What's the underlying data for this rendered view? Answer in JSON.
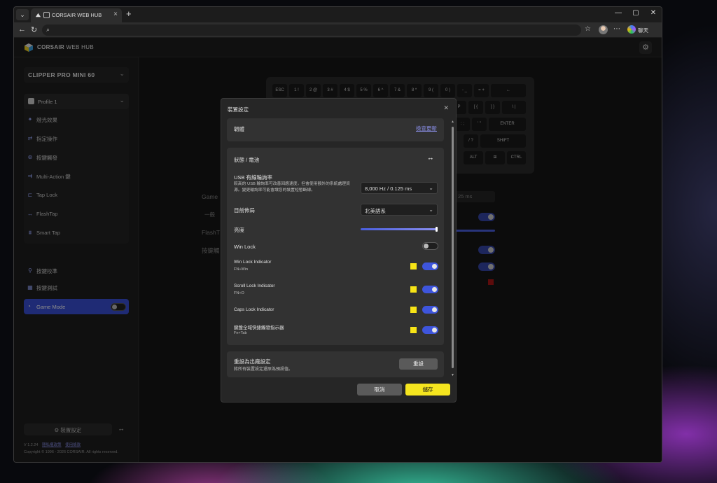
{
  "browser": {
    "tab_title": "CORSAIR WEB HUB",
    "chat_label": "聊天"
  },
  "app": {
    "brand_bold": "CORSAIR",
    "brand_rest": "WEB HUB"
  },
  "sidebar": {
    "device": "CLIPPER PRO MINI 60",
    "profile": "Profile 1",
    "items": [
      {
        "label": "燈光效果",
        "icon": "sparkle-icon"
      },
      {
        "label": "指定操作",
        "icon": "assign-icon"
      },
      {
        "label": "按鍵觸發",
        "icon": "key-trigger-icon"
      },
      {
        "label": "Multi-Action 鍵",
        "icon": "multi-action-icon"
      },
      {
        "label": "Tap Lock",
        "icon": "tap-lock-icon"
      },
      {
        "label": "FlashTap",
        "icon": "flashtap-icon"
      },
      {
        "label": "Smart Tap",
        "icon": "smart-tap-icon"
      }
    ],
    "tools": [
      {
        "label": "按鍵校準",
        "icon": "calibrate-icon"
      },
      {
        "label": "按鍵測試",
        "icon": "key-test-icon"
      }
    ],
    "game_mode": "Game Mode",
    "device_settings": "裝置設定",
    "version": "V 1.2.24",
    "version_links": [
      "隱私權政策",
      "使用條款"
    ],
    "copyright": "Copyright © 1996 - 2026 CORSAIR. All rights reserved."
  },
  "keyboard": {
    "row1": [
      "ESC",
      "1 !",
      "2 @",
      "3 #",
      "4 $",
      "5 %",
      "6 ^",
      "7 &",
      "8 *",
      "9 (",
      "0 )",
      "- _",
      "= +",
      "←"
    ],
    "row2": [
      "P",
      "[ {",
      "] }",
      "\\ |"
    ],
    "row3": [
      ": ;",
      "' \"",
      "ENTER"
    ],
    "row4": [
      "/ ?",
      "SHIFT"
    ],
    "row5": [
      "ALT",
      "⊞",
      "CTRL"
    ]
  },
  "background": {
    "label_game": "Game",
    "label_general": "一般",
    "label_flashtap": "FlashT",
    "label_key_trigger": "按鍵觸",
    "select_value": "25 ms"
  },
  "modal": {
    "title": "裝置設定",
    "firmware": {
      "label": "韌體",
      "check_update": "檢查更新"
    },
    "status": {
      "title": "狀態 / 電池",
      "usb_rate_label": "USB 有線輪詢率",
      "usb_rate_desc": "較高的 USB 輪詢率可改善回應速度，但會使用額外的系統處理資源。變更輪詢率可能會讓您的裝置短暫斷線。",
      "usb_rate_value": "8,000 Hz / 0.125 ms",
      "layout_label": "目前佈局",
      "layout_value": "北美語系",
      "brightness_label": "亮度",
      "brightness_value": 1.0,
      "winlock_label": "Win Lock",
      "winlock_on": false,
      "indicators": [
        {
          "label": "Win Lock Indicator",
          "sub": "FN+Win",
          "color": "#f7e416",
          "on": true
        },
        {
          "label": "Scroll Lock Indicator",
          "sub": "FN+O",
          "color": "#f7e416",
          "on": true
        },
        {
          "label": "Caps Lock Indicator",
          "sub": "",
          "color": "#f7e416",
          "on": true
        },
        {
          "label": "鍵盤全域快捷觸發指示器",
          "sub": "Fn+Tab",
          "color": "#f7e416",
          "on": true
        }
      ]
    },
    "reset": {
      "label": "重設為出廠設定",
      "desc": "將所有裝置設定還原為預設值。",
      "button": "重設"
    },
    "cancel": "取消",
    "save": "儲存"
  }
}
